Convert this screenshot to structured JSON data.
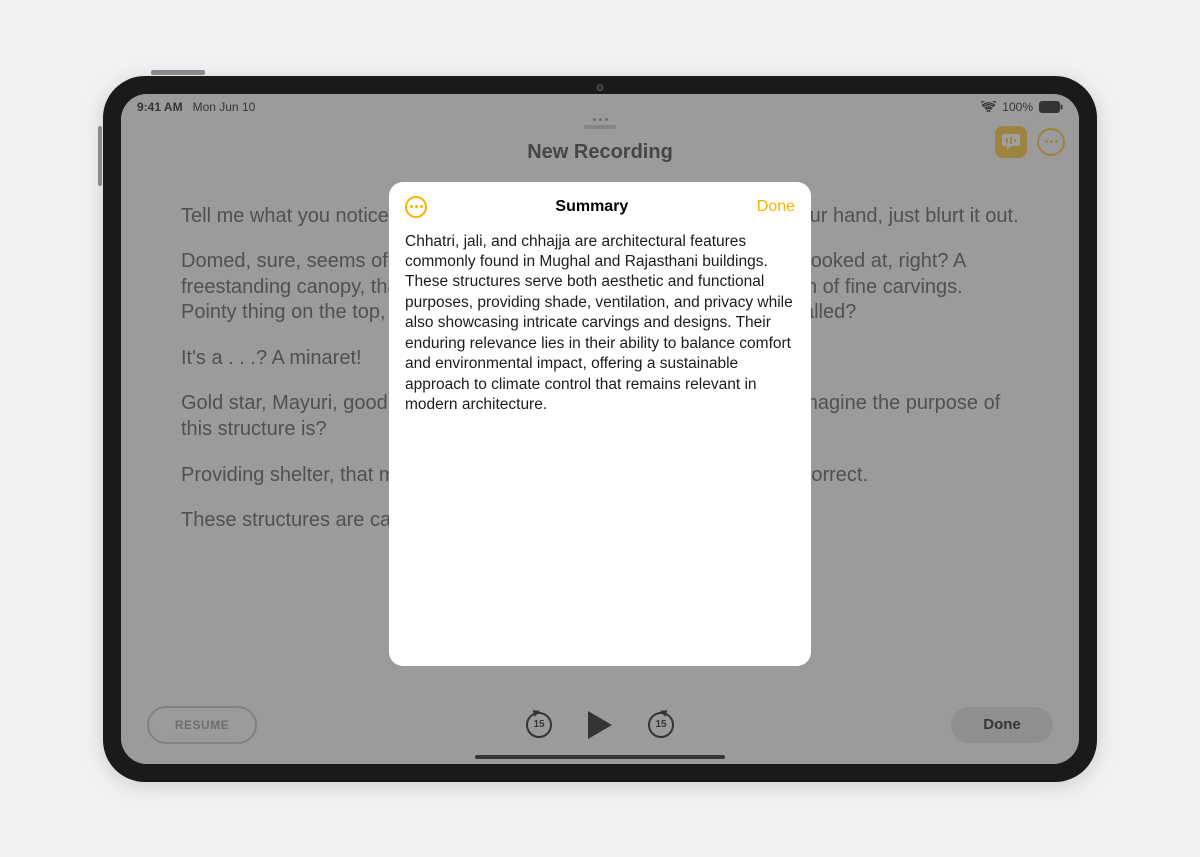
{
  "status": {
    "time": "9:41 AM",
    "date": "Mon Jun 10",
    "battery_pct": "100%"
  },
  "recording": {
    "title": "New Recording"
  },
  "transcript": {
    "p1": "Tell me what you notice about this structure? You don't have to raise your hand, just blurt it out.",
    "p2": "Domed, sure, seems of a piece with some of the other buildings we've looked at, right? A freestanding canopy, that's an astute observation. Supported I see a ton of fine carvings. Pointy thing on the top, OK fair enough, do we remember what that's called?",
    "p3": "It's a . . .? A minaret!",
    "p4": "Gold star, Mayuri, good memory! OK so what we see, what would we imagine the purpose of this structure is?",
    "p5": "Providing shelter, that makes perfect sense, in fact you are absolutely correct.",
    "p6": "These structures are cal"
  },
  "controls": {
    "resume": "RESUME",
    "done": "Done",
    "skip_seconds": "15"
  },
  "modal": {
    "title": "Summary",
    "done": "Done",
    "body": "Chhatri, jali, and chhajja are architectural features commonly found in Mughal and Rajasthani buildings. These structures serve both aesthetic and functional purposes, providing shade, ventilation, and privacy while also showcasing intricate carvings and designs. Their enduring relevance lies in their ability to balance comfort and environmental impact, offering a sustainable approach to climate control that remains relevant in modern architecture."
  },
  "colors": {
    "accent": "#f5b400"
  }
}
